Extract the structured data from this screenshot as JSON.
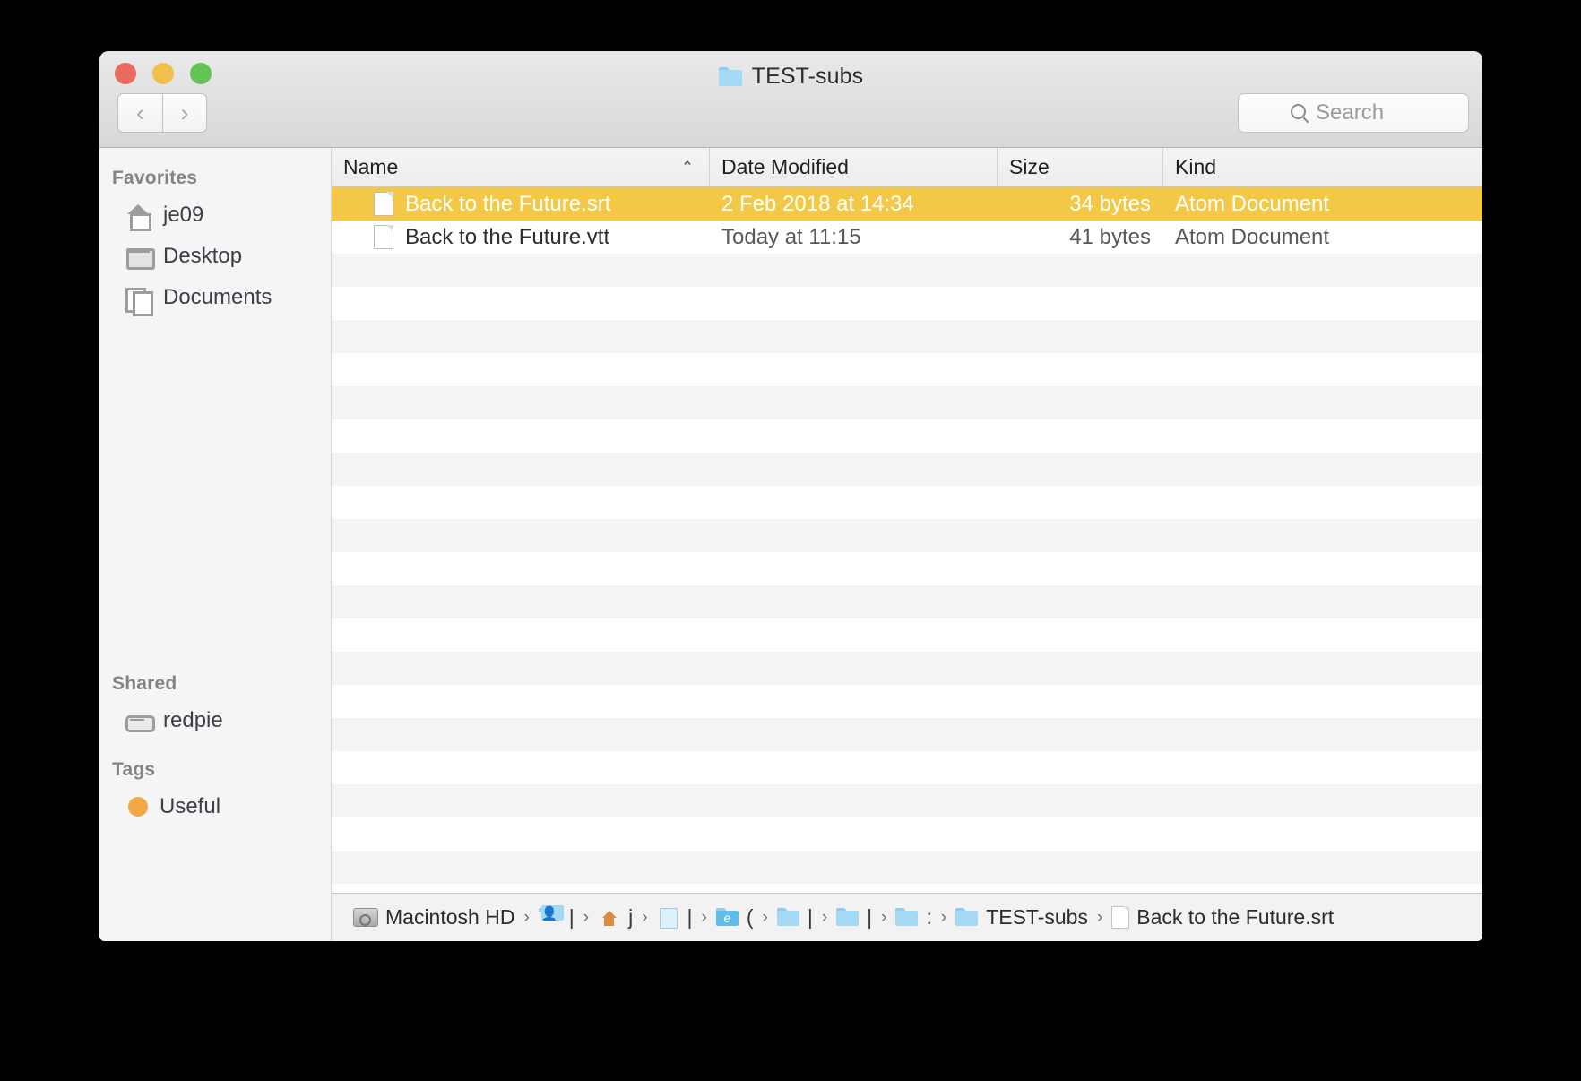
{
  "window": {
    "title": "TEST-subs",
    "title_icon": "folder-icon",
    "traffic_lights": [
      {
        "name": "close",
        "color": "#e8695e"
      },
      {
        "name": "minimize",
        "color": "#f0bf4c"
      },
      {
        "name": "zoom",
        "color": "#61c454"
      }
    ]
  },
  "toolbar": {
    "back_label": "‹",
    "forward_label": "›",
    "search_placeholder": "Search",
    "search_value": ""
  },
  "sidebar": {
    "sections": [
      {
        "header": "Favorites",
        "items": [
          {
            "label": "je09",
            "icon": "home-icon"
          },
          {
            "label": "Desktop",
            "icon": "desktop-icon"
          },
          {
            "label": "Documents",
            "icon": "documents-icon"
          }
        ]
      },
      {
        "header": "Shared",
        "items": [
          {
            "label": "redpie",
            "icon": "server-icon"
          }
        ]
      },
      {
        "header": "Tags",
        "items": [
          {
            "label": "Useful",
            "icon": "tag-dot-icon",
            "color": "#f0a945"
          }
        ]
      }
    ]
  },
  "filelist": {
    "columns": [
      {
        "label": "Name",
        "sorted": true,
        "sort_caret": "⌃"
      },
      {
        "label": "Date Modified",
        "sorted": false
      },
      {
        "label": "Size",
        "sorted": false
      },
      {
        "label": "Kind",
        "sorted": false
      }
    ],
    "rows": [
      {
        "name": "Back to the Future.srt",
        "date_modified": "2 Feb 2018 at 14:34",
        "size": "34 bytes",
        "kind": "Atom Document",
        "selected": true
      },
      {
        "name": "Back to the Future.vtt",
        "date_modified": "Today at 11:15",
        "size": "41 bytes",
        "kind": "Atom Document",
        "selected": false
      }
    ],
    "selection_color": "#f3c847",
    "empty_row_count": 19
  },
  "pathbar": {
    "separator": "›",
    "crumbs": [
      {
        "label": "Macintosh HD",
        "icon": "harddisk-icon"
      },
      {
        "label": "|",
        "icon": "users-folder-icon"
      },
      {
        "label": "j",
        "icon": "home-folder-icon"
      },
      {
        "label": "|",
        "icon": "document-icon"
      },
      {
        "label": "(",
        "icon": "e-folder-icon"
      },
      {
        "label": "|",
        "icon": "folder-icon"
      },
      {
        "label": "|",
        "icon": "folder-icon"
      },
      {
        "label": ":",
        "icon": "folder-icon"
      },
      {
        "label": "TEST-subs",
        "icon": "folder-icon"
      },
      {
        "label": "Back to the Future.srt",
        "icon": "file-icon"
      }
    ]
  }
}
